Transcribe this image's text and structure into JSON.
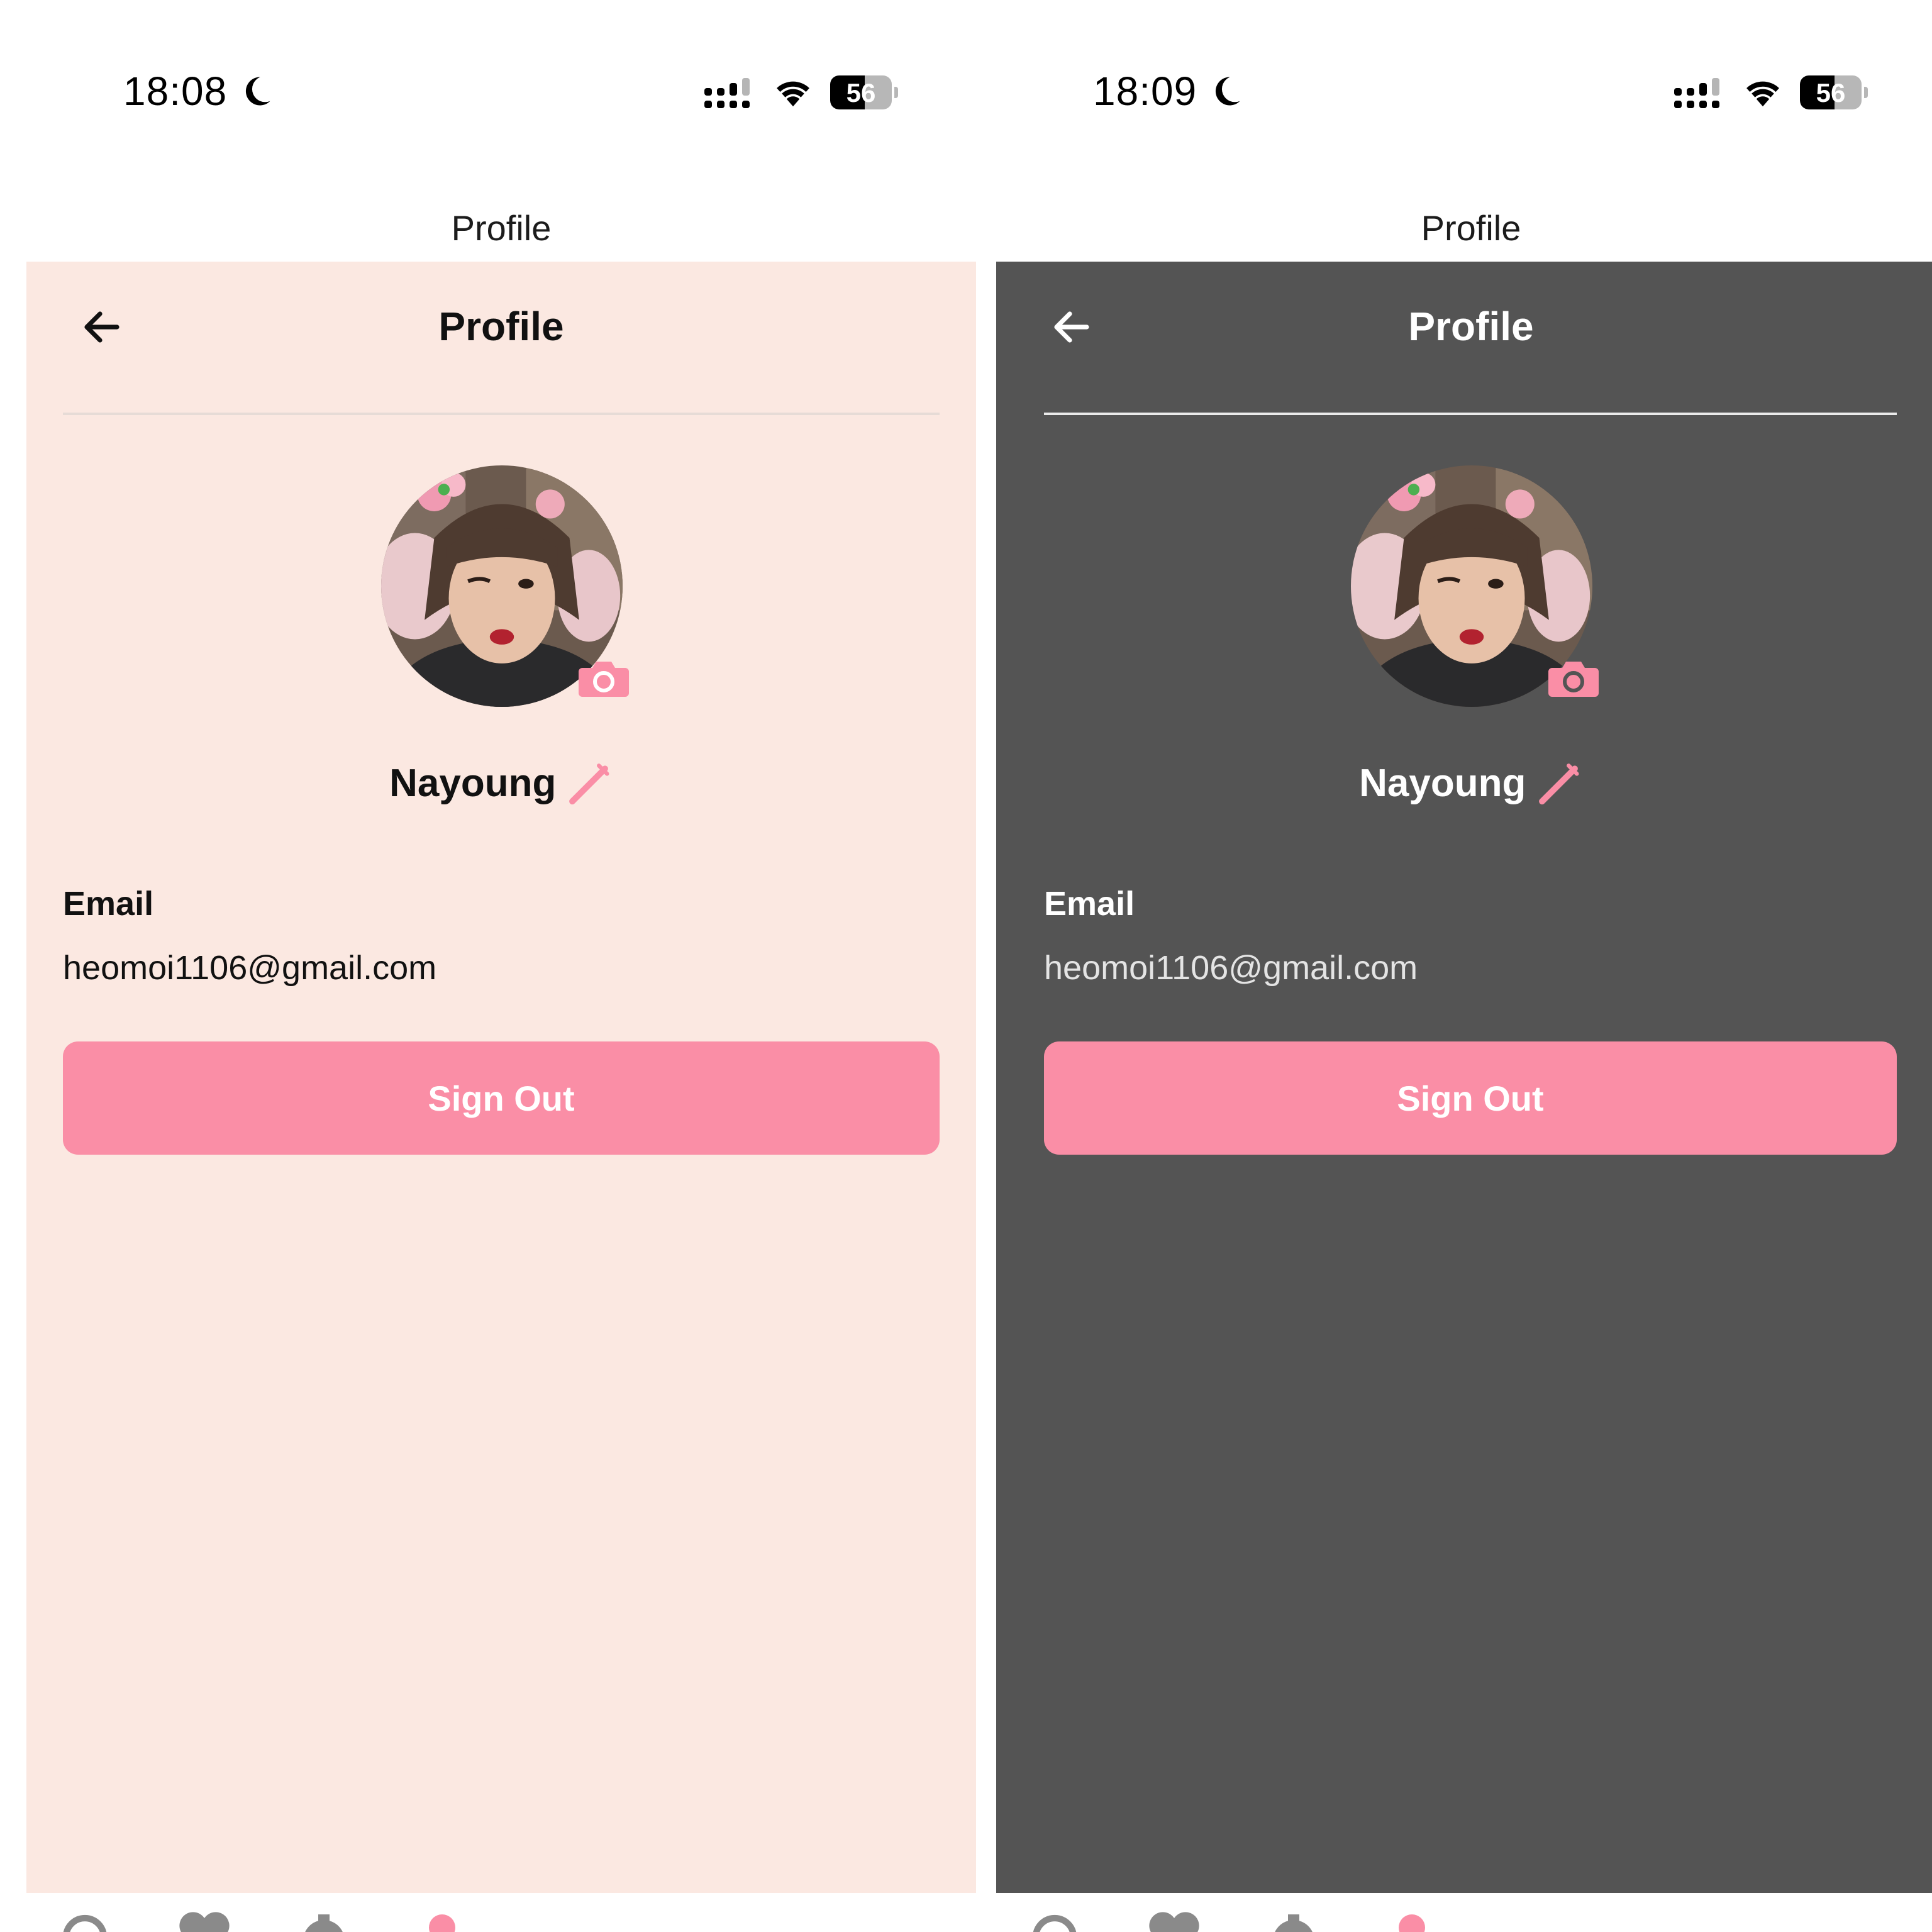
{
  "colors": {
    "accent_pink": "#fa8ea6",
    "light_background": "#fbe8e1",
    "dark_background": "#545454"
  },
  "screens": [
    {
      "theme": "light",
      "status": {
        "time": "18:08",
        "battery": "56",
        "battery_level": 0.56
      },
      "nav_title": "Profile",
      "header": {
        "title": "Profile"
      },
      "profile": {
        "name": "Nayoung",
        "email_label": "Email",
        "email": "heomoi1106@gmail.com"
      },
      "sign_out_label": "Sign Out",
      "tabs": [
        "search-icon",
        "heart-icon",
        "gear-icon",
        "person-icon"
      ],
      "active_tab": "person-icon"
    },
    {
      "theme": "dark",
      "status": {
        "time": "18:09",
        "battery": "56",
        "battery_level": 0.56
      },
      "nav_title": "Profile",
      "header": {
        "title": "Profile"
      },
      "profile": {
        "name": "Nayoung",
        "email_label": "Email",
        "email": "heomoi1106@gmail.com"
      },
      "sign_out_label": "Sign Out",
      "tabs": [
        "search-icon",
        "heart-icon",
        "gear-icon",
        "person-icon"
      ],
      "active_tab": "person-icon"
    }
  ]
}
